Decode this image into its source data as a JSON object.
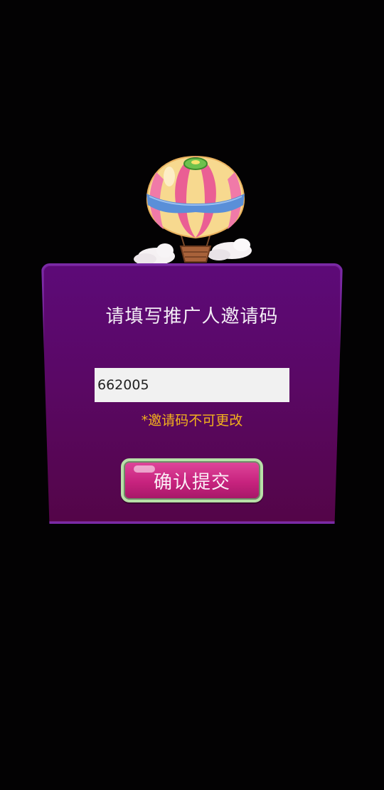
{
  "dialog": {
    "title": "请填写推广人邀请码",
    "invite_code_value": "662005",
    "note": "*邀请码不可更改",
    "submit_label": "确认提交"
  },
  "colors": {
    "background": "#030203",
    "panel": "#5a0868",
    "panel_border": "#7a2aa6",
    "note": "#f3b21c",
    "button": "#c7237e",
    "button_border": "#b8e0a8"
  },
  "icons": {
    "decoration": "hot-air-balloon-icon"
  }
}
